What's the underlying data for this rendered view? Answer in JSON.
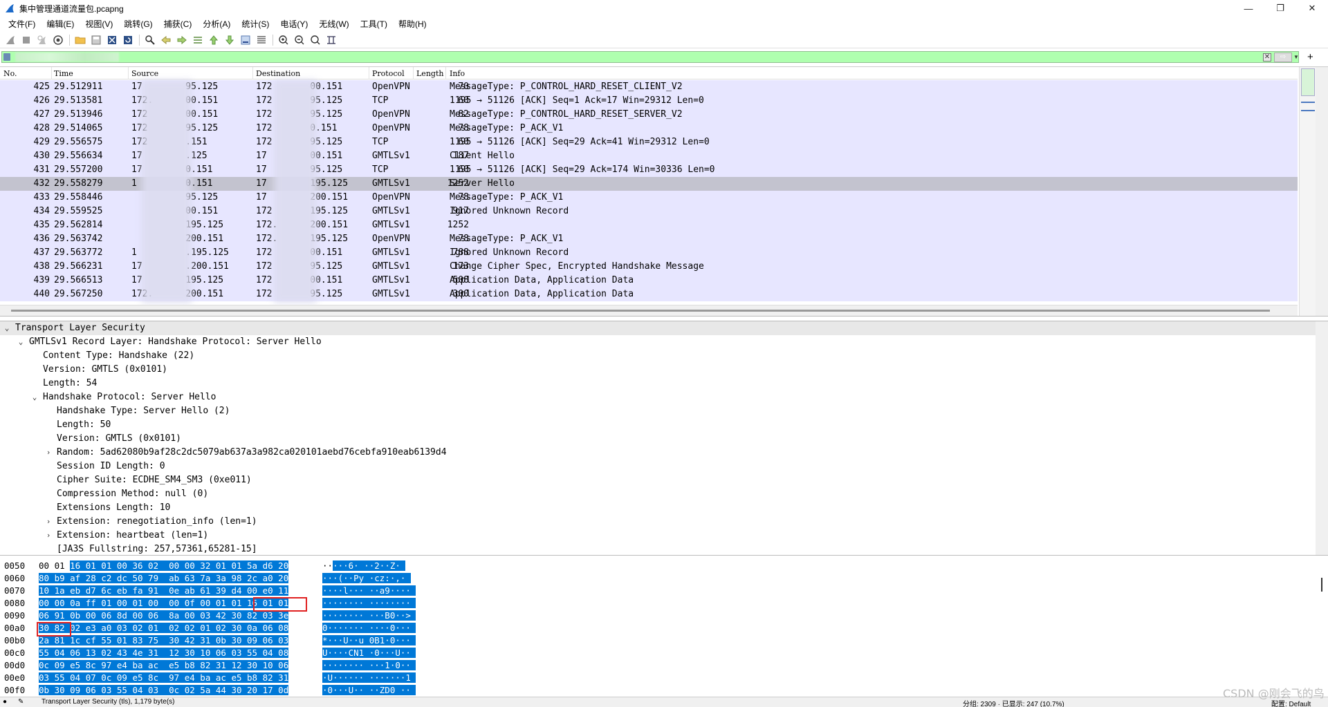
{
  "window": {
    "title": "集中管理通道流量包.pcapng",
    "minimize": "—",
    "maximize": "❐",
    "close": "✕"
  },
  "menu": [
    "文件(F)",
    "编辑(E)",
    "视图(V)",
    "跳转(G)",
    "捕获(C)",
    "分析(A)",
    "统计(S)",
    "电话(Y)",
    "无线(W)",
    "工具(T)",
    "帮助(H)"
  ],
  "toolbar_icons": [
    "shark-fin-start-icon",
    "stop-square-icon",
    "restart-fin-icon",
    "options-gear-icon",
    "open-folder-icon",
    "save-file-icon",
    "close-file-icon",
    "reload-icon",
    "find-packet-icon",
    "go-back-icon",
    "go-forward-icon",
    "go-to-packet-icon",
    "go-first-icon",
    "go-last-icon",
    "auto-scroll-icon",
    "colorize-icon",
    "zoom-in-icon",
    "zoom-out-icon",
    "normal-size-icon",
    "resize-columns-icon"
  ],
  "filter": {
    "value": "",
    "apply": "⇨"
  },
  "packet_columns": {
    "no": "No.",
    "time": "Time",
    "source": "Source",
    "destination": "Destination",
    "protocol": "Protocol",
    "length": "Length",
    "info": "Info"
  },
  "packets": [
    {
      "no": "425",
      "time": "29.512911",
      "src": "17        95.125",
      "dst": "172       00.151",
      "proto": "OpenVPN",
      "len": "70",
      "info": "MessageType: P_CONTROL_HARD_RESET_CLIENT_V2"
    },
    {
      "no": "426",
      "time": "29.513581",
      "src": "172.      00.151",
      "dst": "172       95.125",
      "proto": "TCP",
      "len": "60",
      "info": "1195 → 51126 [ACK] Seq=1 Ack=17 Win=29312 Len=0"
    },
    {
      "no": "427",
      "time": "29.513946",
      "src": "172       00.151",
      "dst": "172       95.125",
      "proto": "OpenVPN",
      "len": "82",
      "info": "MessageType: P_CONTROL_HARD_RESET_SERVER_V2"
    },
    {
      "no": "428",
      "time": "29.514065",
      "src": "172       95.125",
      "dst": "172       0.151",
      "proto": "OpenVPN",
      "len": "78",
      "info": "MessageType: P_ACK_V1"
    },
    {
      "no": "429",
      "time": "29.556575",
      "src": "172       .151",
      "dst": "172       95.125",
      "proto": "TCP",
      "len": "60",
      "info": "1195 → 51126 [ACK] Seq=29 Ack=41 Win=29312 Len=0"
    },
    {
      "no": "430",
      "time": "29.556634",
      "src": "17        .125",
      "dst": "17        00.151",
      "proto": "GMTLSv1",
      "len": "187",
      "info": "Client Hello"
    },
    {
      "no": "431",
      "time": "29.557200",
      "src": "17        0.151",
      "dst": "17        95.125",
      "proto": "TCP",
      "len": "60",
      "info": "1195 → 51126 [ACK] Seq=29 Ack=174 Win=30336 Len=0"
    },
    {
      "no": "432",
      "time": "29.558279",
      "src": "1         0.151",
      "dst": "17        195.125",
      "proto": "GMTLSv1",
      "len": "1252",
      "info": "Server Hello",
      "selected": true
    },
    {
      "no": "433",
      "time": "29.558446",
      "src": "          95.125",
      "dst": "17        200.151",
      "proto": "OpenVPN",
      "len": "78",
      "info": "MessageType: P_ACK_V1"
    },
    {
      "no": "434",
      "time": "29.559525",
      "src": "          00.151",
      "dst": "172       195.125",
      "proto": "GMTLSv1",
      "len": "917",
      "info": "Ignored Unknown Record"
    },
    {
      "no": "435",
      "time": "29.562814",
      "src": "          195.125",
      "dst": "172.      200.151",
      "proto": "GMTLSv1",
      "len": "1252",
      "info": ""
    },
    {
      "no": "436",
      "time": "29.563742",
      "src": "          200.151",
      "dst": "172.      195.125",
      "proto": "OpenVPN",
      "len": "78",
      "info": "MessageType: P_ACK_V1"
    },
    {
      "no": "437",
      "time": "29.563772",
      "src": "1         .195.125",
      "dst": "172       00.151",
      "proto": "GMTLSv1",
      "len": "788",
      "info": "Ignored Unknown Record"
    },
    {
      "no": "438",
      "time": "29.566231",
      "src": "17        .200.151",
      "dst": "172       95.125",
      "proto": "GMTLSv1",
      "len": "173",
      "info": "Change Cipher Spec, Encrypted Handshake Message"
    },
    {
      "no": "439",
      "time": "29.566513",
      "src": "17        195.125",
      "dst": "172       00.151",
      "proto": "GMTLSv1",
      "len": "508",
      "info": "Application Data, Application Data"
    },
    {
      "no": "440",
      "time": "29.567250",
      "src": "172.      200.151",
      "dst": "172       95.125",
      "proto": "GMTLSv1",
      "len": "300",
      "info": "Application Data, Application Data"
    }
  ],
  "details": [
    {
      "indent": 0,
      "arrow": "v",
      "text": "Transport Layer Security",
      "top": true
    },
    {
      "indent": 1,
      "arrow": "v",
      "text": "GMTLSv1 Record Layer: Handshake Protocol: Server Hello"
    },
    {
      "indent": 2,
      "arrow": "",
      "text": "Content Type: Handshake (22)"
    },
    {
      "indent": 2,
      "arrow": "",
      "text": "Version: GMTLS (0x0101)"
    },
    {
      "indent": 2,
      "arrow": "",
      "text": "Length: 54"
    },
    {
      "indent": 2,
      "arrow": "v",
      "text": "Handshake Protocol: Server Hello"
    },
    {
      "indent": 3,
      "arrow": "",
      "text": "Handshake Type: Server Hello (2)"
    },
    {
      "indent": 3,
      "arrow": "",
      "text": "Length: 50"
    },
    {
      "indent": 3,
      "arrow": "",
      "text": "Version: GMTLS (0x0101)"
    },
    {
      "indent": 3,
      "arrow": ">",
      "text": "Random: 5ad62080b9af28c2dc5079ab637a3a982ca020101aebd76cebfa910eab6139d4"
    },
    {
      "indent": 3,
      "arrow": "",
      "text": "Session ID Length: 0"
    },
    {
      "indent": 3,
      "arrow": "",
      "text": "Cipher Suite: ECDHE_SM4_SM3 (0xe011)"
    },
    {
      "indent": 3,
      "arrow": "",
      "text": "Compression Method: null (0)"
    },
    {
      "indent": 3,
      "arrow": "",
      "text": "Extensions Length: 10"
    },
    {
      "indent": 3,
      "arrow": ">",
      "text": "Extension: renegotiation_info (len=1)"
    },
    {
      "indent": 3,
      "arrow": ">",
      "text": "Extension: heartbeat (len=1)"
    },
    {
      "indent": 3,
      "arrow": "",
      "text": "[JA3S Fullstring: 257,57361,65281-15]"
    }
  ],
  "bytes": [
    {
      "off": "0050",
      "pre": "00 01 ",
      "sel": "16 01 01 00 36 02  00 00 32 01 01 5a d6 20",
      "apre": "··",
      "asel": "···6· ··2··Z· "
    },
    {
      "off": "0060",
      "pre": "",
      "sel": "80 b9 af 28 c2 dc 50 79  ab 63 7a 3a 98 2c a0 20",
      "apre": "",
      "asel": "···(··Py ·cz:·,· "
    },
    {
      "off": "0070",
      "pre": "",
      "sel": "10 1a eb d7 6c eb fa 91  0e ab 61 39 d4 00 e0 11",
      "apre": "",
      "asel": "····l··· ··a9···· "
    },
    {
      "off": "0080",
      "pre": "",
      "sel": "00 00 0a ff 01 00 01 00  00 0f 00 01 01 16 01 01",
      "apre": "",
      "asel": "········ ········ "
    },
    {
      "off": "0090",
      "pre": "",
      "sel": "06 91 0b 00 06 8d 00 06  8a 00 03 42 30 82 03 3e",
      "apre": "",
      "asel": "········ ···B0··> "
    },
    {
      "off": "00a0",
      "pre": "",
      "sel": "30 82 02 e3 a0 03 02 01  02 02 01 02 30 0a 06 08",
      "apre": "",
      "asel": "0······· ····0··· "
    },
    {
      "off": "00b0",
      "pre": "",
      "sel": "2a 81 1c cf 55 01 83 75  30 42 31 0b 30 09 06 03",
      "apre": "",
      "asel": "*···U··u 0B1·0··· "
    },
    {
      "off": "00c0",
      "pre": "",
      "sel": "55 04 06 13 02 43 4e 31  12 30 10 06 03 55 04 08",
      "apre": "",
      "asel": "U····CN1 ·0···U·· "
    },
    {
      "off": "00d0",
      "pre": "",
      "sel": "0c 09 e5 8c 97 e4 ba ac  e5 b8 82 31 12 30 10 06",
      "apre": "",
      "asel": "········ ···1·0·· "
    },
    {
      "off": "00e0",
      "pre": "",
      "sel": "03 55 04 07 0c 09 e5 8c  97 e4 ba ac e5 b8 82 31",
      "apre": "",
      "asel": "·U······ ·······1 "
    },
    {
      "off": "00f0",
      "pre": "",
      "sel": "0b 30 09 06 03 55 04 03  0c 02 5a 44 30 20 17 0d",
      "apre": "",
      "asel": "·0···U·· ··ZD0 ·· "
    }
  ],
  "status": {
    "left": "Transport Layer Security (tls), 1,179 byte(s)",
    "packets": "分组: 2309 · 已显示: 247 (10.7%)",
    "profile": "配置: Default"
  },
  "watermark": "CSDN @刚会飞的鸟"
}
